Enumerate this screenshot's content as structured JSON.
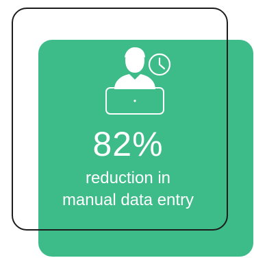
{
  "stat": {
    "value": "82%",
    "caption_line1": "reduction in",
    "caption_line2": "manual data entry"
  },
  "icons": {
    "main": "person-at-laptop-icon",
    "secondary": "clock-icon"
  },
  "colors": {
    "card_green": "#3dbb88",
    "outline": "#1b1b1b",
    "text": "#ffffff"
  }
}
